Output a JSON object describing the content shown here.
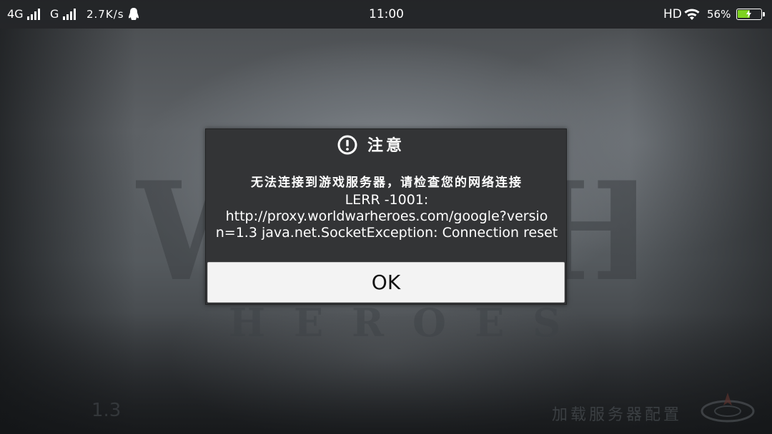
{
  "status_bar": {
    "network_4g": "4G",
    "network_g": "G",
    "speed": "2.7K/s",
    "time": "11:00",
    "hd": "HD",
    "battery_percent": "56%",
    "battery_level": 0.56,
    "battery_color": "#7ed321"
  },
  "background": {
    "version": "1.3",
    "loading_text": "加载服务器配置"
  },
  "dialog": {
    "icon": "alert-circle-icon",
    "title": "注意",
    "message_cn": "无法连接到游戏服务器，请检查您的网络连接",
    "message_lines": [
      "LERR -1001:",
      "http://proxy.worldwarheroes.com/google?versio",
      "n=1.3 java.net.SocketException: Connection reset"
    ],
    "ok_label": "OK"
  }
}
